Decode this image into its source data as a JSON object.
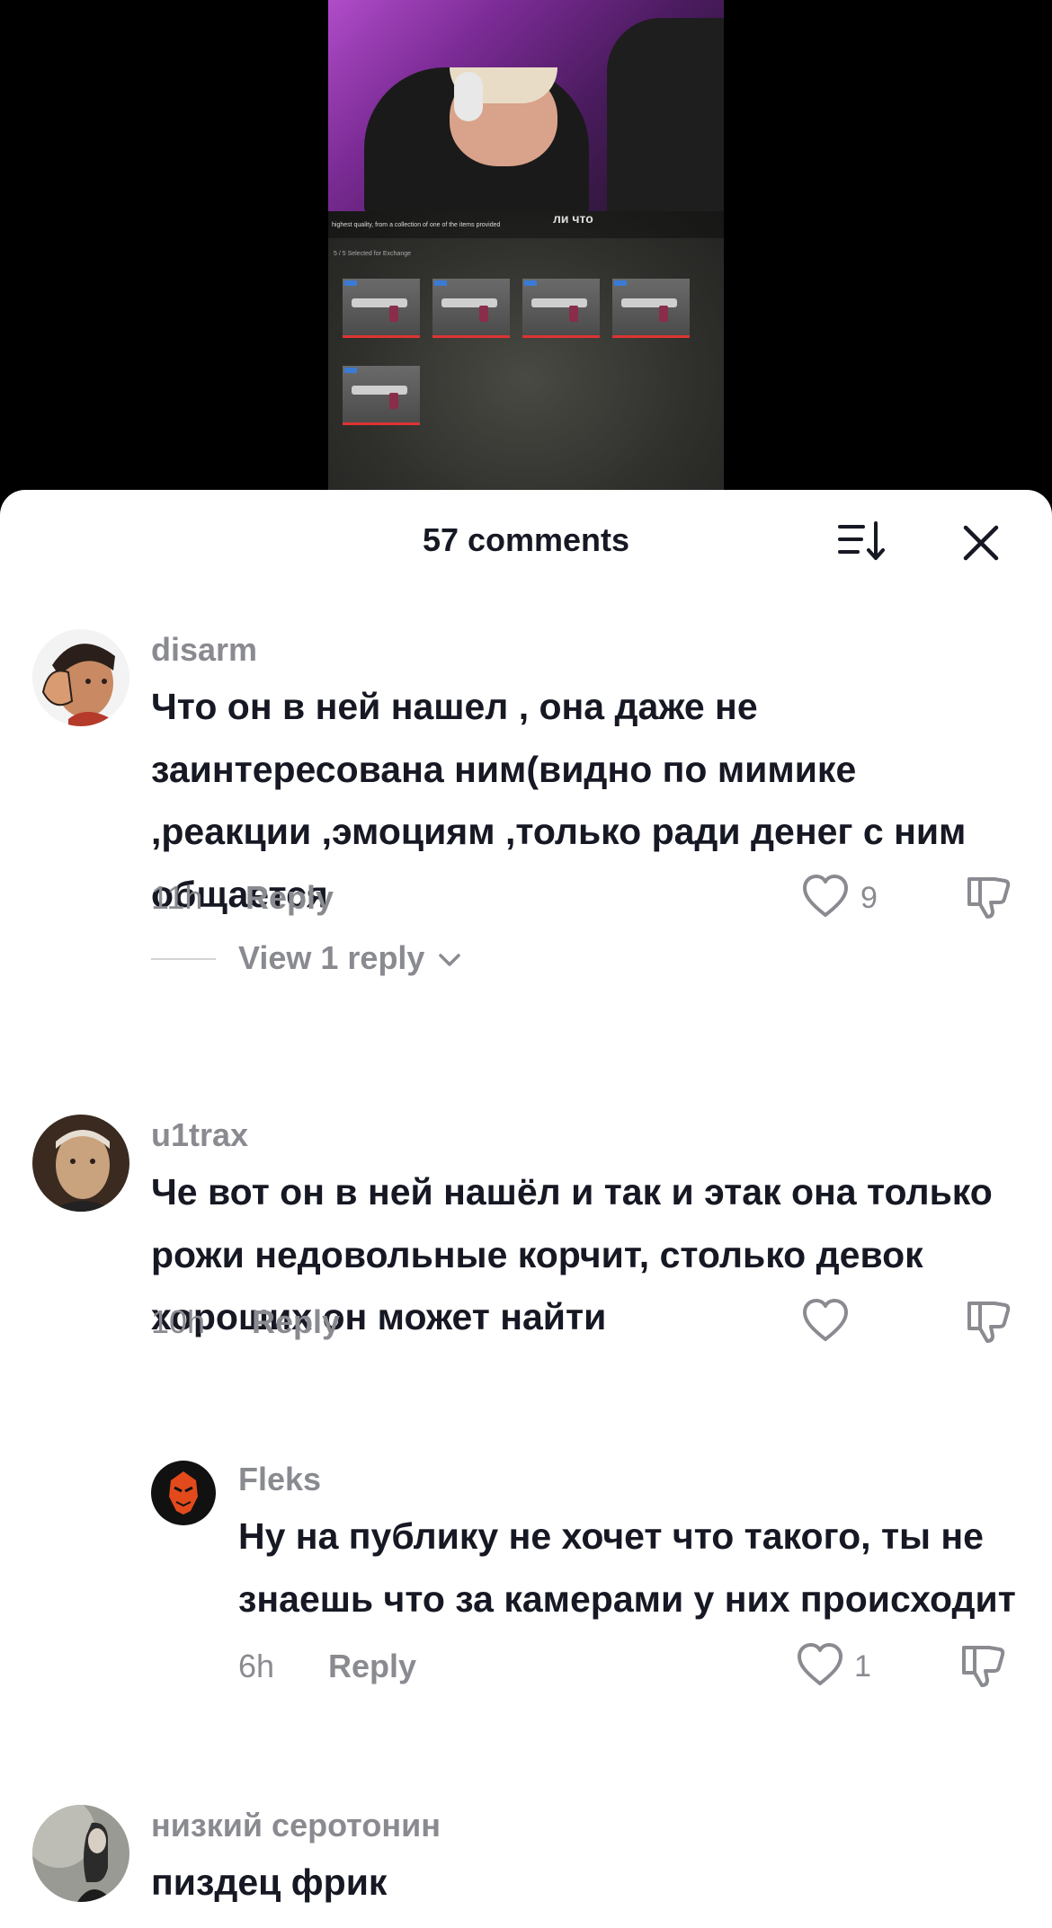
{
  "sheet": {
    "title": "57 comments"
  },
  "video": {
    "game_caption": "highest quality, from a collection of one of the items provided",
    "overlay_text": "ли что",
    "selected_text": "5 / 5 Selected for Exchange"
  },
  "comments": [
    {
      "username": "disarm",
      "text": "Что он в ней нашел , она даже не заинтересована ним(видно по мимике ,реакции ,эмоциям ,только ради денег с ним общается",
      "time": "11h",
      "reply_label": "Reply",
      "likes": "9",
      "view_replies": "View 1 reply"
    },
    {
      "username": "u1trax",
      "text": "Че вот он в ней нашёл и так и этак она только рожи недовольные корчит, столько девок хороших он может найти",
      "time": "10h",
      "reply_label": "Reply",
      "likes": ""
    },
    {
      "username": "Fleks",
      "text": "Ну на публику не хочет что такого, ты не знаешь что за камерами у них происходит",
      "time": "6h",
      "reply_label": "Reply",
      "likes": "1"
    },
    {
      "username": "низкий серотонин",
      "text": "пиздец фрик"
    }
  ],
  "icons": {
    "sort": "sort-icon",
    "close": "close-icon",
    "like": "heart-icon",
    "dislike": "thumbs-down-icon",
    "chevron": "chevron-down-icon"
  }
}
